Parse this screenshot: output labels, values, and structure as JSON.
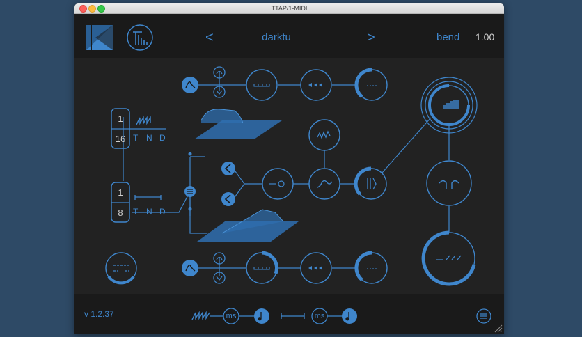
{
  "window": {
    "title": "TTAP/1-MIDI"
  },
  "header": {
    "prev_label": "<",
    "next_label": ">",
    "preset_name": "darktu",
    "param_label": "bend",
    "param_value": "1.00"
  },
  "sync_stacks": [
    {
      "numerator": "1",
      "denominator": "16",
      "modes": [
        "T",
        "N",
        "D"
      ]
    },
    {
      "numerator": "1",
      "denominator": "8",
      "modes": [
        "T",
        "N",
        "D"
      ]
    }
  ],
  "footer": {
    "version": "v 1.2.37",
    "unit_label_1": "ms",
    "unit_label_2": "ms"
  },
  "colors": {
    "accent": "#3f86cc",
    "accent_fill": "#2f6fb0",
    "background": "#222222",
    "header_bg": "#1a1a1a",
    "desktop": "#2e4a66"
  }
}
